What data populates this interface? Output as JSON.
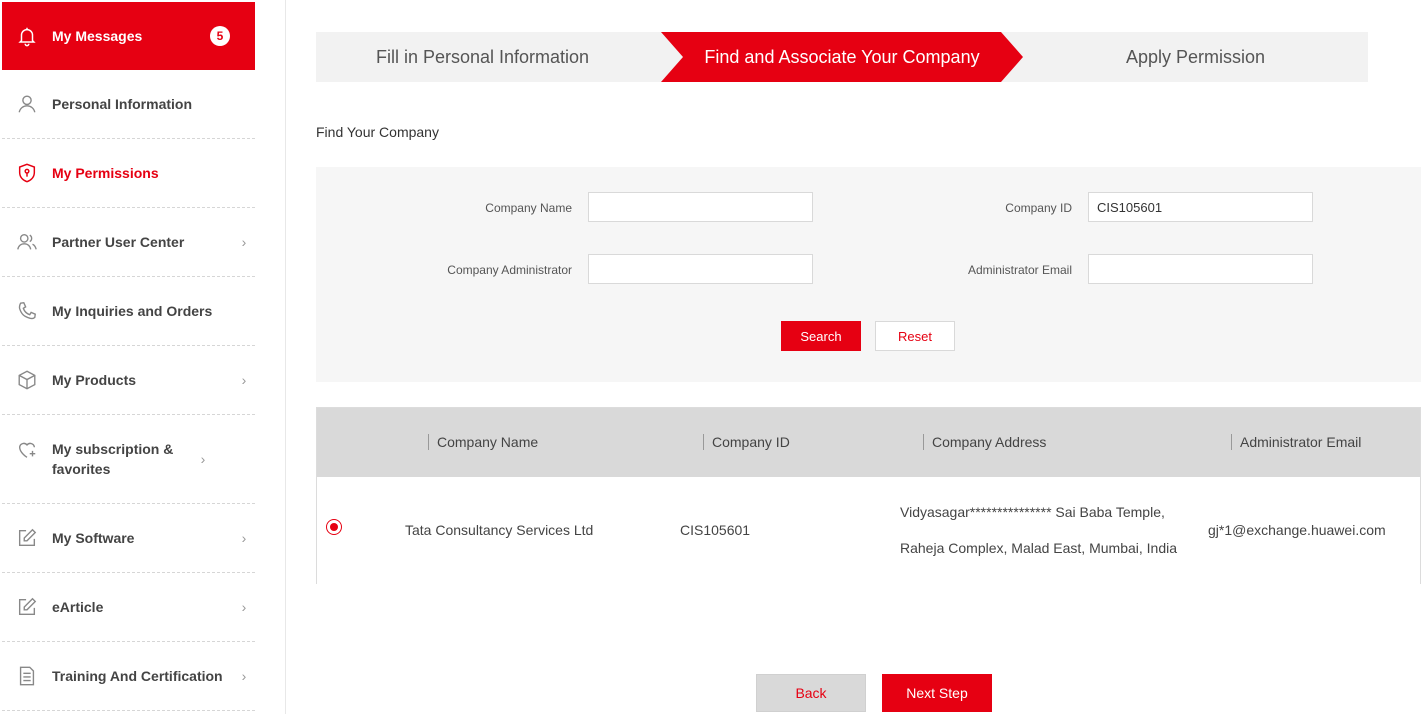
{
  "sidebar": {
    "items": [
      {
        "label": "My Messages",
        "icon": "bell-icon",
        "badge": "5"
      },
      {
        "label": "Personal Information",
        "icon": "user-icon"
      },
      {
        "label": "My Permissions",
        "icon": "shield-icon"
      },
      {
        "label": "Partner User Center",
        "icon": "users-icon",
        "chevron": "›"
      },
      {
        "label": "My Inquiries and Orders",
        "icon": "phone-icon"
      },
      {
        "label": "My Products",
        "icon": "box-icon",
        "chevron": "›"
      },
      {
        "label": "My subscription & favorites",
        "icon": "heart-plus-icon",
        "chevron": "›"
      },
      {
        "label": "My Software",
        "icon": "edit-icon",
        "chevron": "›"
      },
      {
        "label": "eArticle",
        "icon": "edit-icon",
        "chevron": "›"
      },
      {
        "label": "Training And Certification",
        "icon": "document-icon",
        "chevron": "›"
      }
    ]
  },
  "steps": [
    {
      "label": "Fill in Personal Information"
    },
    {
      "label": "Find and Associate Your Company"
    },
    {
      "label": "Apply Permission"
    }
  ],
  "section_title": "Find Your Company",
  "form": {
    "company_name_label": "Company Name",
    "company_name_value": "",
    "company_id_label": "Company ID",
    "company_id_value": "CIS105601",
    "company_admin_label": "Company Administrator",
    "company_admin_value": "",
    "admin_email_label": "Administrator Email",
    "admin_email_value": "",
    "search_label": "Search",
    "reset_label": "Reset"
  },
  "table": {
    "headers": [
      "Company Name",
      "Company ID",
      "Company Address",
      "Administrator Email"
    ],
    "rows": [
      {
        "company_name": "Tata Consultancy Services Ltd",
        "company_id": "CIS105601",
        "address_line1": "Vidyasagar*************** Sai Baba Temple,",
        "address_line2": "Raheja Complex, Malad East, Mumbai, India",
        "admin_email": "gj*1@exchange.huawei.com"
      }
    ]
  },
  "footer": {
    "back_label": "Back",
    "next_label": "Next Step"
  },
  "colors": {
    "accent": "#e60012",
    "header_bg": "#d9d9d9",
    "form_bg": "#f6f6f6"
  }
}
